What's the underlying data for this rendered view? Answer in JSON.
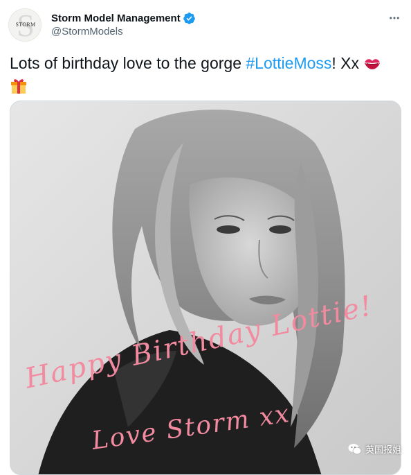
{
  "account": {
    "display_name": "Storm Model Management",
    "handle": "@StormModels",
    "avatar_wordmark": "STORM",
    "verified": true
  },
  "tweet": {
    "text_before": "Lots of birthday love to the gorge ",
    "hashtag": "#LottieMoss",
    "text_after": "! Xx ",
    "emojis": [
      "kiss-mark",
      "wrapped-gift"
    ]
  },
  "media": {
    "caption_line1": "Happy Birthday Lottie!",
    "caption_line2": "Love Storm xx"
  },
  "watermark": {
    "label": "英国报姐"
  },
  "colors": {
    "accent": "#1d9bf0",
    "text": "#0f1419",
    "secondary": "#536471",
    "script_pink": "#f28aa0"
  }
}
